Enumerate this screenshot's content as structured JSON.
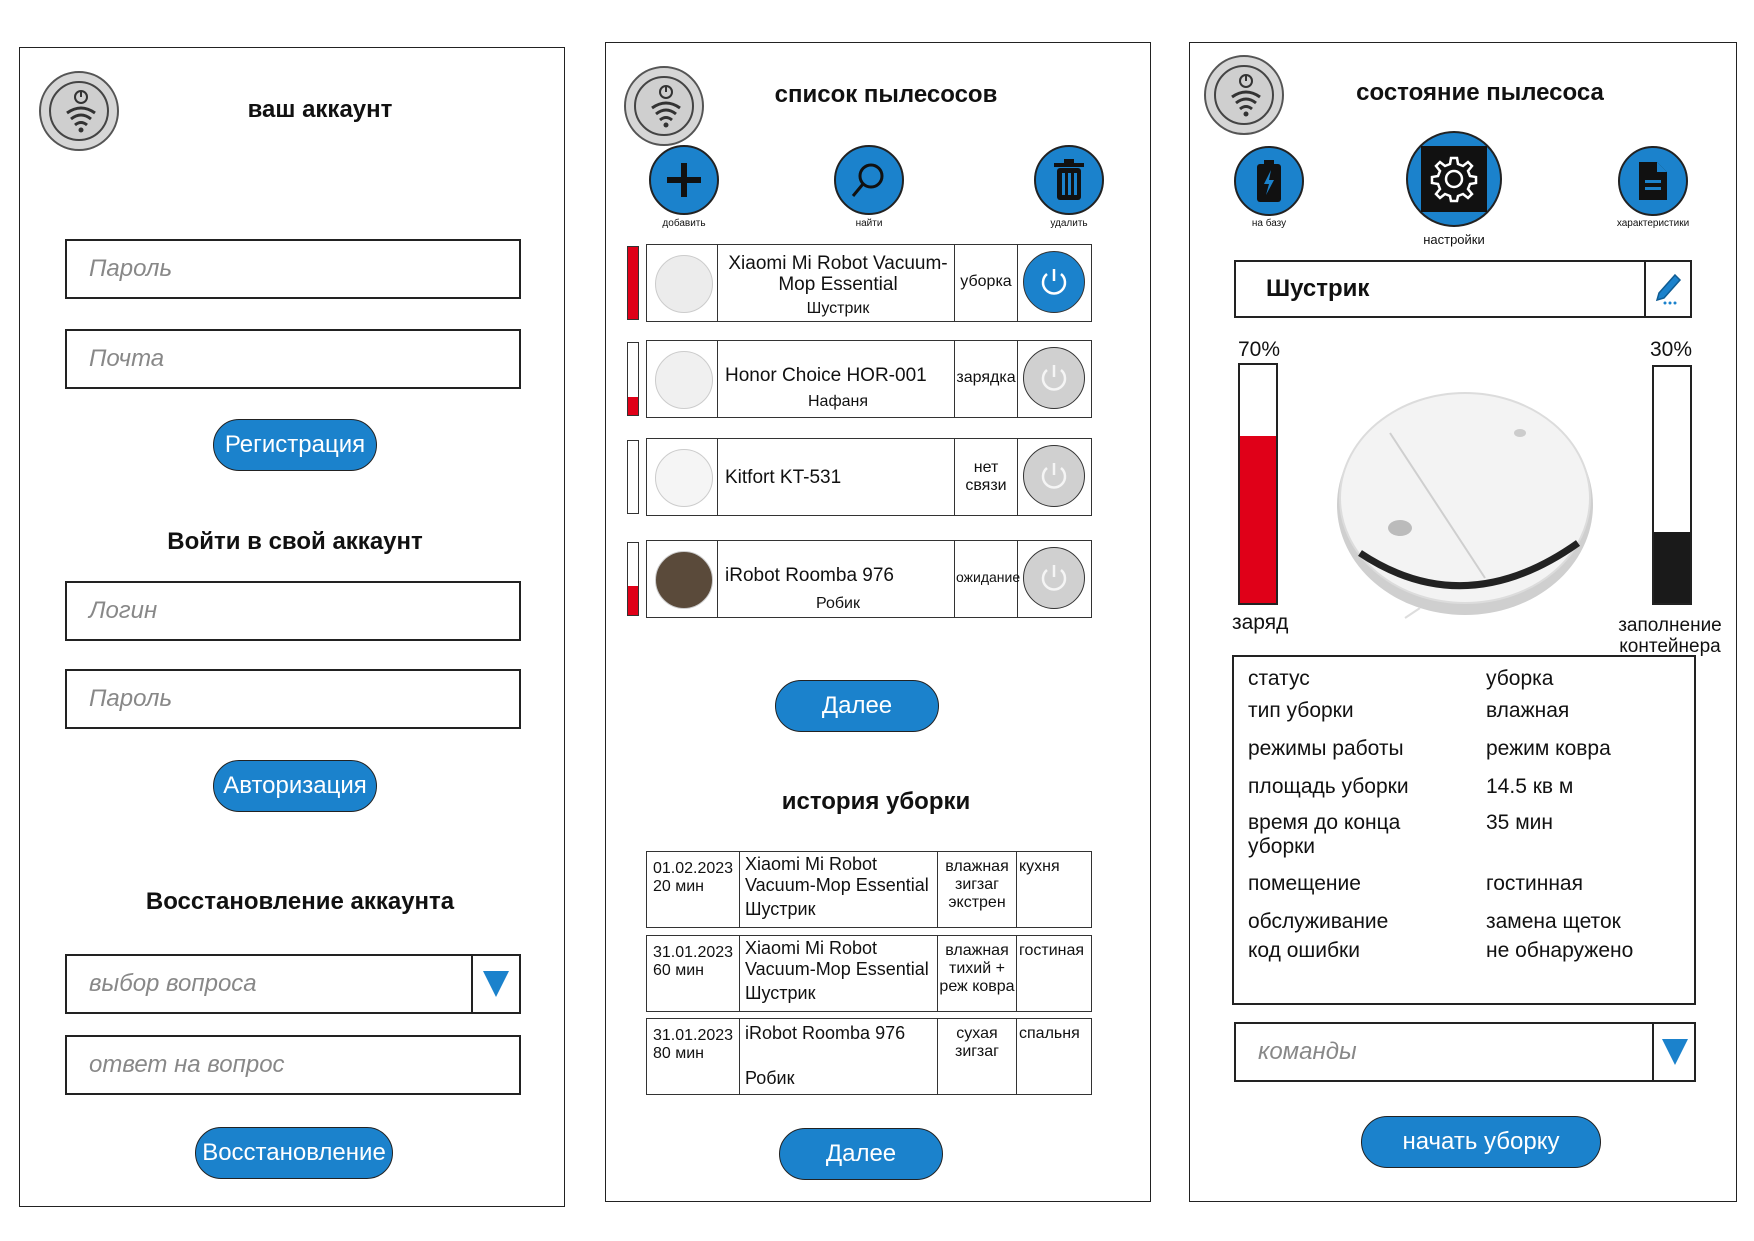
{
  "colors": {
    "accent": "#1b82cc",
    "danger": "#e00018",
    "dark": "#1a1a1a"
  },
  "panel1": {
    "title": "ваш аккаунт",
    "password_placeholder": "Пароль",
    "email_placeholder": "Почта",
    "register_label": "Регистрация",
    "login_heading": "Войти в свой аккаунт",
    "login_placeholder": "Логин",
    "login_password_placeholder": "Пароль",
    "auth_label": "Авторизация",
    "recovery_heading": "Восстановление аккаунта",
    "question_placeholder": "выбор вопроса",
    "answer_placeholder": "ответ на вопрос",
    "recovery_label": "Восстановление"
  },
  "panel2": {
    "title": "список пылесосов",
    "actions": [
      {
        "label": "добавить",
        "icon": "plus-icon"
      },
      {
        "label": "найти",
        "icon": "search-icon"
      },
      {
        "label": "удалить",
        "icon": "trash-icon"
      }
    ],
    "vacuums": [
      {
        "model": "Xiaomi Mi Robot Vacuum-Mop Essential",
        "name": "Шустрик",
        "status": "уборка",
        "charge": 1.0,
        "active": true
      },
      {
        "model": "Honor Choice HOR-001",
        "name": "Нафаня",
        "status": "зарядка",
        "charge": 0.25,
        "active": false
      },
      {
        "model": "Kitfort KT-531",
        "name": "",
        "status": "нет связи",
        "charge": 0,
        "active": false
      },
      {
        "model": "iRobot Roomba 976",
        "name": "Робик",
        "status": "ожидание",
        "charge": 0.4,
        "active": false
      }
    ],
    "next_label": "Далее",
    "history_title": "история уборки",
    "history": [
      {
        "date": "01.02.2023",
        "duration": "20 мин",
        "model": "Xiaomi Mi Robot Vacuum-Mop Essential",
        "name": "Шустрик",
        "mode": "влажная зигзаг экстрен",
        "room": "кухня"
      },
      {
        "date": "31.01.2023",
        "duration": "60 мин",
        "model": "Xiaomi Mi Robot Vacuum-Mop Essential",
        "name": "Шустрик",
        "mode": "влажная тихий + реж ковра",
        "room": "гостиная"
      },
      {
        "date": "31.01.2023",
        "duration": "80 мин",
        "model": "iRobot Roomba 976",
        "name": "Робик",
        "mode": "сухая зигзаг",
        "room": "спальня"
      }
    ],
    "history_next_label": "Далее"
  },
  "panel3": {
    "title": "состояние пылесоса",
    "btn_base": "на базу",
    "btn_settings": "настройки",
    "btn_specs": "характеристики",
    "name": "Шустрик",
    "charge_pct": "70%",
    "charge_value": 0.7,
    "charge_label": "заряд",
    "container_pct": "30%",
    "container_value": 0.3,
    "container_label": "заполнение контейнера",
    "info": [
      {
        "k": "статус",
        "v": "уборка"
      },
      {
        "k": "тип уборки",
        "v": "влажная"
      },
      {
        "k": "режимы  работы",
        "v": "режим ковра"
      },
      {
        "k": "площадь уборки",
        "v": "14.5 кв м"
      },
      {
        "k": "время до конца уборки",
        "v": "35 мин"
      },
      {
        "k": "помещение",
        "v": "гостинная"
      },
      {
        "k": "обслуживание",
        "v": "замена щеток"
      },
      {
        "k": "код ошибки",
        "v": "не обнаружено"
      }
    ],
    "commands_placeholder": "команды",
    "start_label": "начать уборку"
  }
}
